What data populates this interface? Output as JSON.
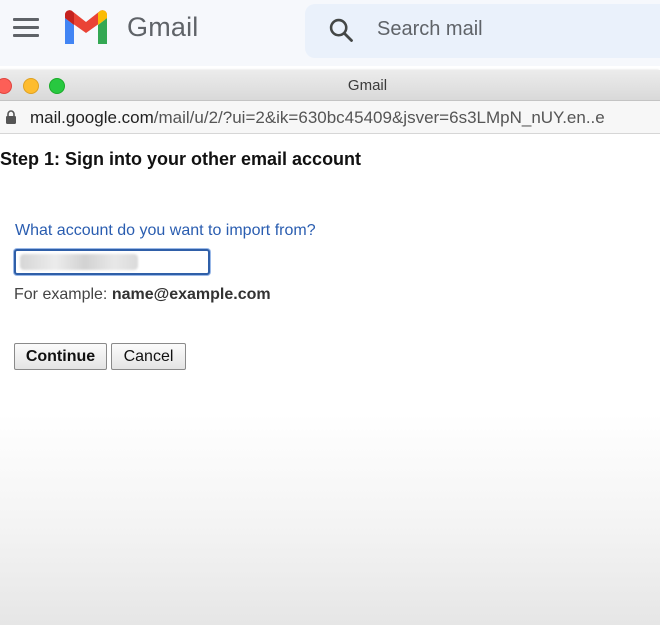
{
  "header": {
    "app_name": "Gmail",
    "search_placeholder": "Search mail"
  },
  "window": {
    "title": "Gmail",
    "url_host": "mail.google.com",
    "url_path": "/mail/u/2/?ui=2&ik=630bc45409&jsver=6s3LMpN_nUY.en..e"
  },
  "form": {
    "heading": "Step 1: Sign into your other email account",
    "question": "What account do you want to import from?",
    "account_input_value": "",
    "example_prefix": "For example: ",
    "example_value": "name@example.com",
    "continue_label": "Continue",
    "cancel_label": "Cancel"
  },
  "colors": {
    "link_blue": "#2a5db0",
    "gmail_red": "#ea4335",
    "gmail_blue": "#4285f4",
    "gmail_green": "#34a853",
    "gmail_yellow": "#fbbc04"
  }
}
